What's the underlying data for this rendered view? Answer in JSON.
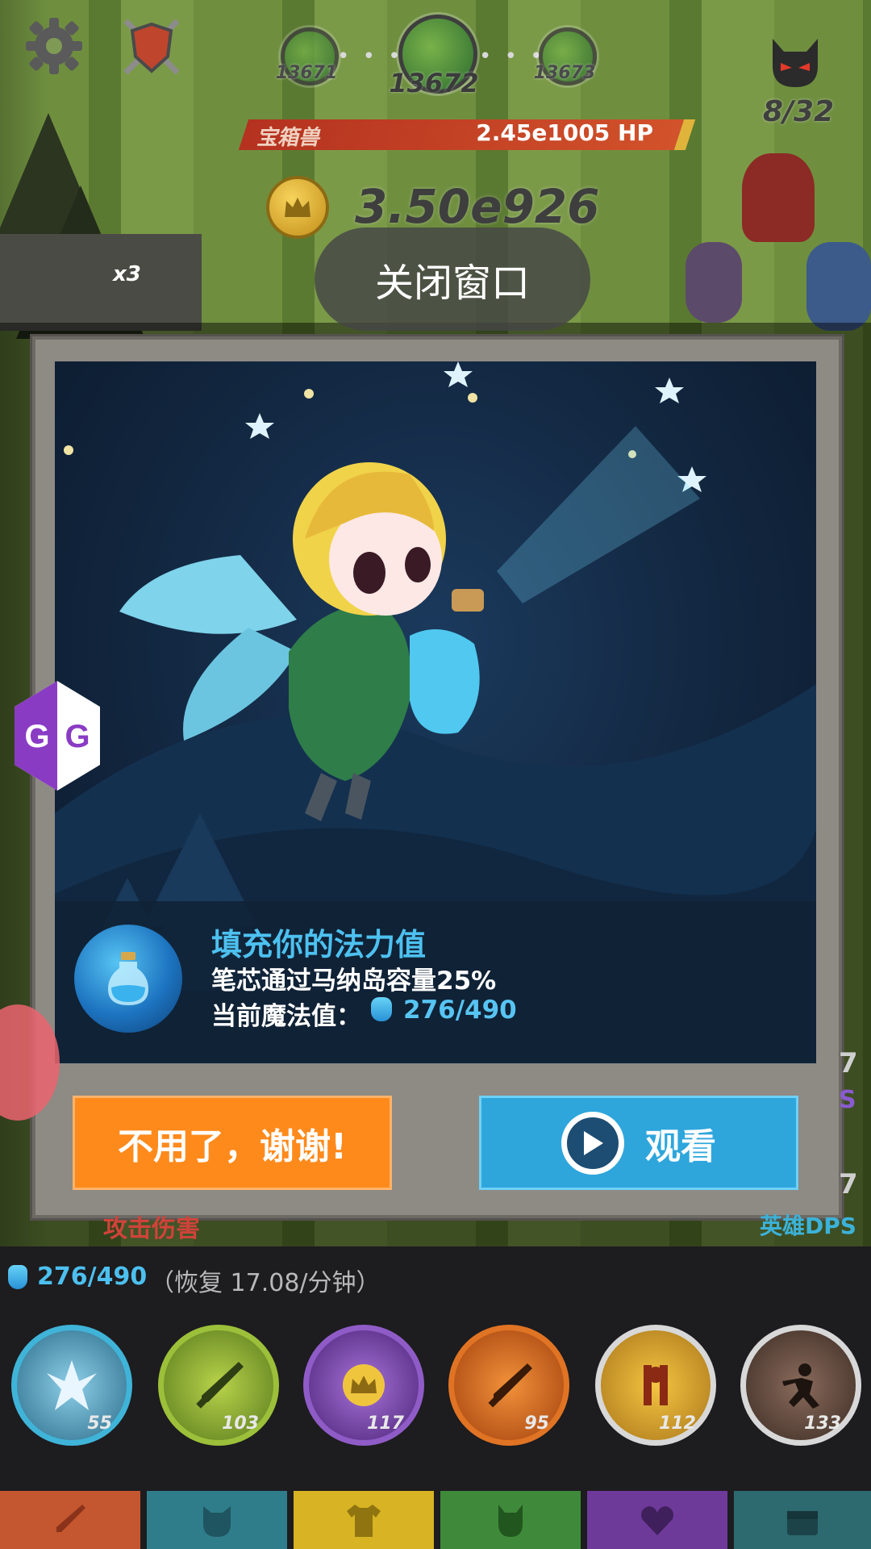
{
  "hud": {
    "stages": [
      {
        "number": "13671"
      },
      {
        "number": "13672"
      },
      {
        "number": "13673"
      }
    ],
    "boss_progress": "8/32",
    "enemy_name": "宝箱兽",
    "enemy_hp": "2.45e1005 HP",
    "gold": "3.50e926",
    "crowd_multiplier": "x3"
  },
  "close_button": "关闭窗口",
  "dialog": {
    "title": "填充你的法力值",
    "description": "笔芯通过马纳岛容量25%",
    "mana_label": "当前魔法值：",
    "mana_value": "276/490",
    "decline_button": "不用了，谢谢!",
    "watch_button": "观看"
  },
  "gg_badge": "GG",
  "background_labels": {
    "attack": "攻击伤害",
    "hero_dps": "英雄DPS",
    "side_digit_1": "7",
    "side_letter": "S",
    "side_digit_2": "7"
  },
  "mana_bar": {
    "value": "276/490",
    "regen": "（恢复 17.08/分钟）"
  },
  "skills": [
    {
      "level": "55"
    },
    {
      "level": "103"
    },
    {
      "level": "117"
    },
    {
      "level": "95"
    },
    {
      "level": "112"
    },
    {
      "level": "133"
    }
  ],
  "colors": {
    "accent_orange": "#ff8a1c",
    "accent_blue": "#2ea6dc",
    "mana_blue": "#4dc1f0",
    "hp_red": "#b4321f"
  }
}
